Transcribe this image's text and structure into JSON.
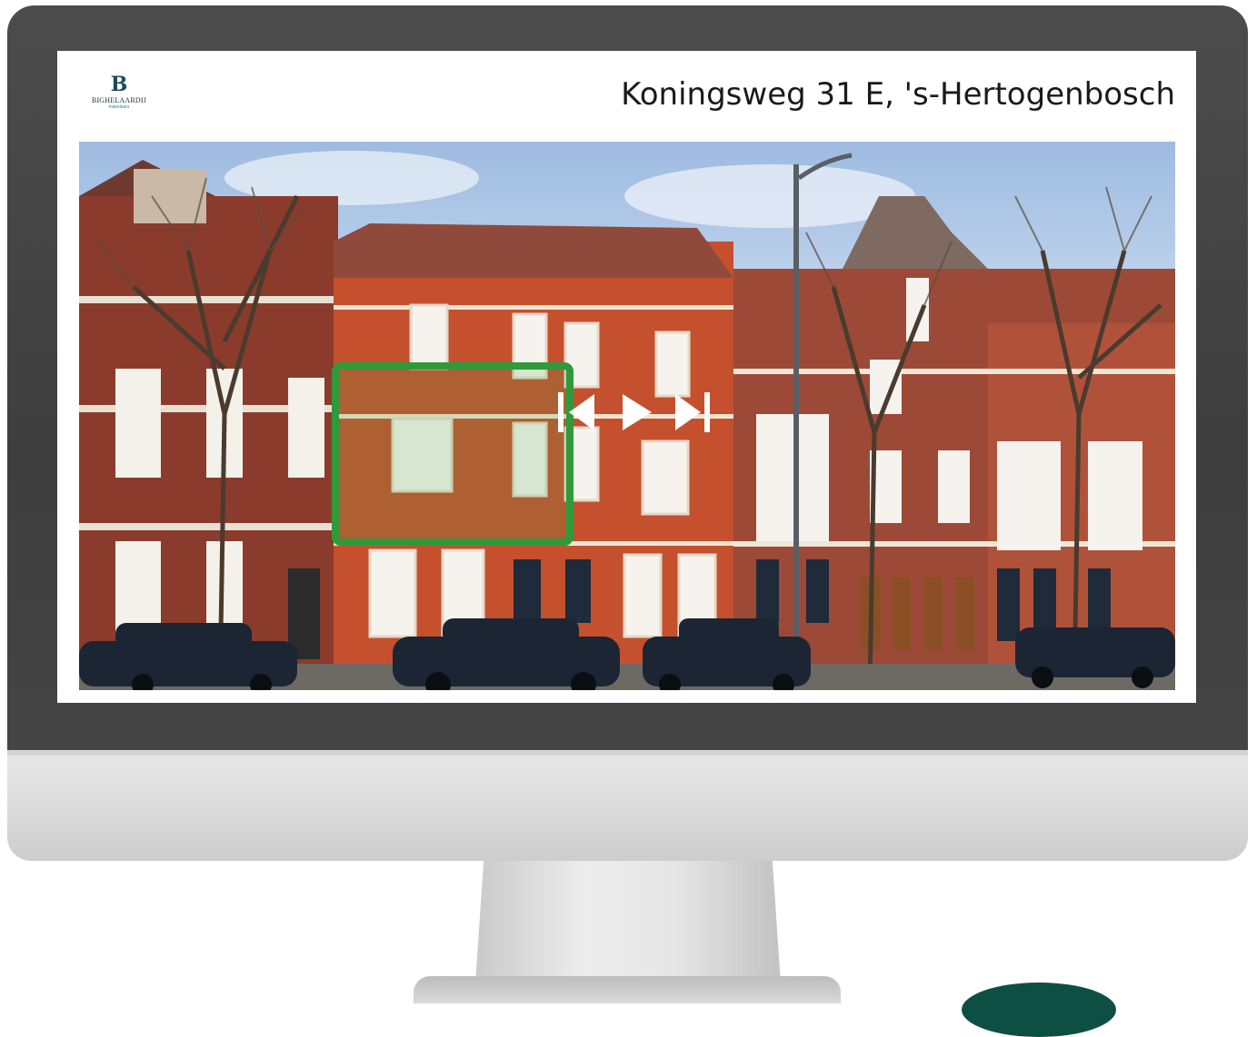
{
  "brand": {
    "logo_mark": "B",
    "name": "BIGHELAARDIJ",
    "tagline": "makelaars"
  },
  "listing": {
    "address": "Koningsweg 31 E, 's-Hertogenbosch"
  },
  "player": {
    "controls": [
      "previous-icon",
      "play-icon",
      "skip-to-end-icon"
    ]
  },
  "colors": {
    "highlight": "#2f9a3a",
    "brand_teal": "#1e4a5e",
    "bezel": "#444444"
  }
}
